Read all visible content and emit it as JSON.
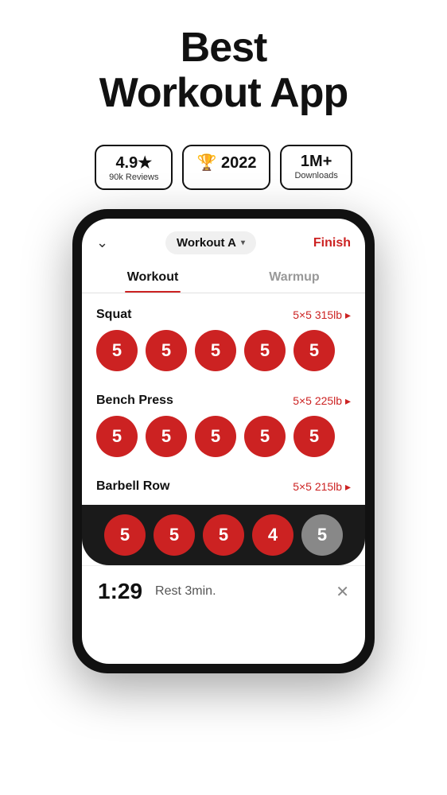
{
  "header": {
    "title": "Best",
    "title2": "Workout App"
  },
  "badges": [
    {
      "main": "4.9★",
      "sub": "90k Reviews"
    },
    {
      "main": "🏆 2022",
      "sub": ""
    },
    {
      "main": "1M+",
      "sub": "Downloads"
    }
  ],
  "app": {
    "workout_name": "Workout A",
    "finish_label": "Finish",
    "tabs": [
      {
        "label": "Workout",
        "active": true
      },
      {
        "label": "Warmup",
        "active": false
      }
    ],
    "exercises": [
      {
        "name": "Squat",
        "info": "5×5 315lb ▸",
        "sets": [
          5,
          5,
          5,
          5,
          5
        ],
        "inactive": []
      },
      {
        "name": "Bench Press",
        "info": "5×5 225lb ▸",
        "sets": [
          5,
          5,
          5,
          5,
          5
        ],
        "inactive": []
      },
      {
        "name": "Barbell Row",
        "info": "5×5 215lb ▸",
        "sets": [
          5,
          5,
          5,
          4,
          5
        ],
        "inactive": [
          4
        ]
      }
    ],
    "bottom_sets": [
      5,
      5,
      5,
      4,
      5
    ],
    "bottom_inactive": [
      4
    ],
    "rest_time": "1:29",
    "rest_label": "Rest 3min."
  }
}
